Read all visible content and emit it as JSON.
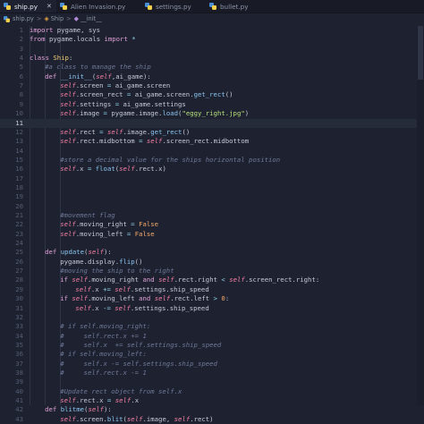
{
  "tabs": [
    {
      "label": "ship.py",
      "active": true,
      "close": "✕"
    },
    {
      "label": "Alien Invasion.py",
      "active": false
    },
    {
      "label": "settings.py",
      "active": false
    },
    {
      "label": "bullet.py",
      "active": false
    }
  ],
  "breadcrumb": {
    "file": "ship.py",
    "sep1": ">",
    "cls": "Ship",
    "sep2": ">",
    "method": "__init__"
  },
  "current_line": 11,
  "lines": [
    {
      "n": "1"
    },
    {
      "n": "2"
    },
    {
      "n": "3"
    },
    {
      "n": "4"
    },
    {
      "n": "5"
    },
    {
      "n": "6"
    },
    {
      "n": "7"
    },
    {
      "n": "8"
    },
    {
      "n": "9"
    },
    {
      "n": "10"
    },
    {
      "n": "11"
    },
    {
      "n": "12"
    },
    {
      "n": "13"
    },
    {
      "n": "14"
    },
    {
      "n": "15"
    },
    {
      "n": "16"
    },
    {
      "n": "17"
    },
    {
      "n": "18"
    },
    {
      "n": "19"
    },
    {
      "n": "20"
    },
    {
      "n": "21"
    },
    {
      "n": "22"
    },
    {
      "n": "23"
    },
    {
      "n": "24"
    },
    {
      "n": "25"
    },
    {
      "n": "26"
    },
    {
      "n": "27"
    },
    {
      "n": "28"
    },
    {
      "n": "29"
    },
    {
      "n": "30"
    },
    {
      "n": "31"
    },
    {
      "n": "32"
    },
    {
      "n": "33"
    },
    {
      "n": "34"
    },
    {
      "n": "35"
    },
    {
      "n": "36"
    },
    {
      "n": "37"
    },
    {
      "n": "38"
    },
    {
      "n": "39"
    },
    {
      "n": "40"
    },
    {
      "n": "41"
    }
  ],
  "code": {
    "l1": "import pygame, sys",
    "l2": "from pygame.locals import *",
    "l4": "class Ship:",
    "l5": "#a class to manage the ship",
    "l6": "def __init__(self,ai_game):",
    "l7": "self.screen = ai_game.screen",
    "l8": "self.screen_rect = ai_game.screen.get_rect()",
    "l9": "self.settings = ai_game.settings",
    "l10": "self.image = pygame.image.load(\"eggy_right.jpg\")",
    "l12": "self.rect = self.image.get_rect()",
    "l13": "self.rect.midbottom = self.screen_rect.midbottom",
    "l15": "#store a decimal value for the ships horizontal position",
    "l16": "self.x = float(self.rect.x)",
    "l21": "#movement flag",
    "l22": "self.moving_right = False",
    "l23": "self.moving_left = False",
    "l25": "def update(self):",
    "l26": "pygame.display.flip()",
    "l27": "#moving the ship to the right",
    "l28": "if self.moving_right and self.rect.right < self.screen_rect.right:",
    "l29": "self.x += self.settings.ship_speed",
    "l30": "if self.moving_left and self.rect.left > 0:",
    "l31": "self.x -= self.settings.ship_speed",
    "l33": "# if self.moving_right:",
    "l34": "#     self.rect.x += 1",
    "l35": "#     self.x  += self.settings.ship_speed",
    "l36": "# if self.moving_left:",
    "l37": "#     self.x -= self.settings.ship_speed",
    "l38": "#     self.rect.x -= 1",
    "l40": "#Update rect object from self.x",
    "l41": "self.rect.x = self.x",
    "l42": "def blitme(self):",
    "l43": "self.screen.blit(self.image, self.rect)"
  },
  "colors": {
    "background": "#1e2230",
    "keyword": "#e0a0d8",
    "self": "#f27ea3",
    "function": "#8ac4f0",
    "class": "#f0cf78",
    "string": "#b8e07a",
    "number": "#f3a86a",
    "comment": "#6e7898"
  }
}
